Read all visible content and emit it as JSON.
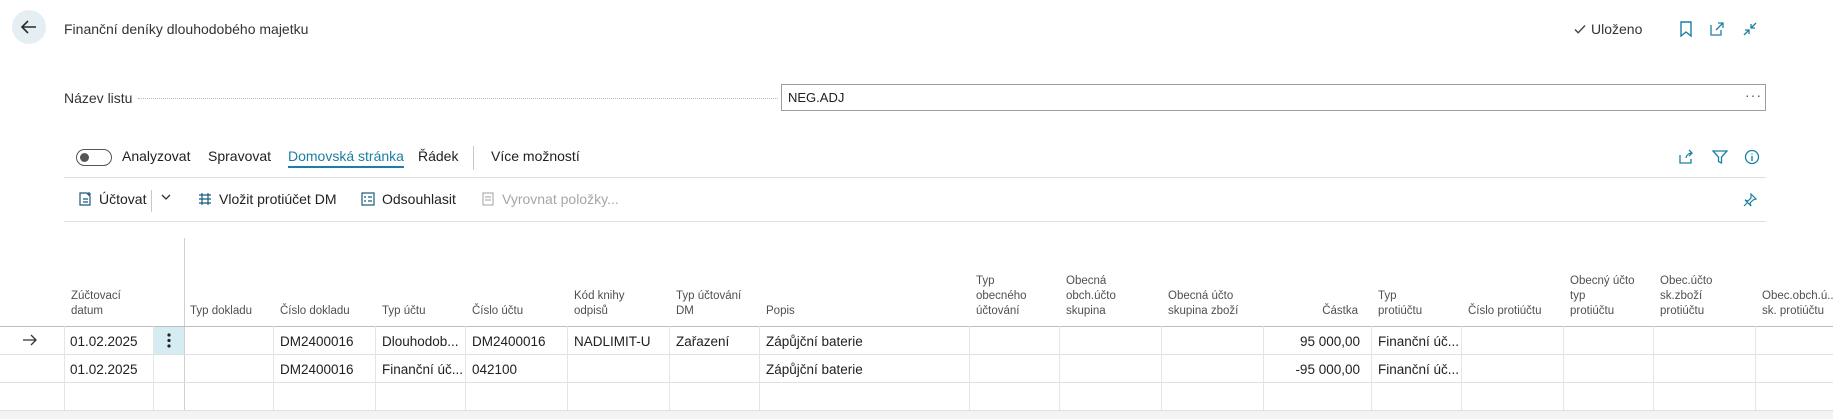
{
  "header": {
    "title": "Finanční deníky dlouhodobého majetku",
    "saved_label": "Uloženo"
  },
  "batch": {
    "label": "Název listu",
    "value": "NEG.ADJ",
    "more": "···"
  },
  "actionbar": {
    "analyze_label": "Analyzovat",
    "tabs": [
      "Spravovat",
      "Domovská stránka",
      "Řádek"
    ],
    "more_label": "Více možností"
  },
  "commands": {
    "post": "Účtovat",
    "insert_balancing": "Vložit protiúčet DM",
    "reconcile": "Odsouhlasit",
    "apply_entries": "Vyrovnat položky..."
  },
  "grid": {
    "columns": [
      {
        "l1": "Zúčtovací",
        "l2": "datum",
        "l3": ""
      },
      {
        "l1": "",
        "l2": "",
        "l3": "Typ dokladu"
      },
      {
        "l1": "",
        "l2": "",
        "l3": "Číslo dokladu"
      },
      {
        "l1": "",
        "l2": "",
        "l3": "Typ účtu"
      },
      {
        "l1": "",
        "l2": "",
        "l3": "Číslo účtu"
      },
      {
        "l1": "Kód knihy",
        "l2": "odpisů",
        "l3": ""
      },
      {
        "l1": "Typ účtování",
        "l2": "DM",
        "l3": ""
      },
      {
        "l1": "",
        "l2": "",
        "l3": "Popis"
      },
      {
        "l1": "Typ",
        "l2": "obecného",
        "l3": "účtování"
      },
      {
        "l1": "Obecná",
        "l2": "obch.účto",
        "l3": "skupina"
      },
      {
        "l1": "Obecná účto",
        "l2": "skupina zboží",
        "l3": ""
      },
      {
        "l1": "",
        "l2": "",
        "l3": "Částka"
      },
      {
        "l1": "Typ",
        "l2": "protiúčtu",
        "l3": ""
      },
      {
        "l1": "",
        "l2": "",
        "l3": "Číslo protiúčtu"
      },
      {
        "l1": "Obecný účto",
        "l2": "typ",
        "l3": "protiúčtu"
      },
      {
        "l1": "Obec.účto",
        "l2": "sk.zboží",
        "l3": "protiúčtu"
      },
      {
        "l1": "",
        "l2": "Obec.obch.ú...",
        "l3": "sk. protiúčtu"
      }
    ],
    "rows": [
      [
        "01.02.2025",
        "",
        "DM2400016",
        "Dlouhodob...",
        "DM2400016",
        "NADLIMIT-U",
        "Zařazení",
        "Zápůjční baterie",
        "",
        "",
        "",
        "95 000,00",
        "Finanční úč...",
        "",
        "",
        "",
        ""
      ],
      [
        "01.02.2025",
        "",
        "DM2400016",
        "Finanční úč...",
        "042100",
        "",
        "",
        "Zápůjční baterie",
        "",
        "",
        "",
        "-95 000,00",
        "Finanční úč...",
        "",
        "",
        "",
        ""
      ]
    ]
  },
  "colors": {
    "accent": "#1a7fa1",
    "back_button_bg": "#e4eef3",
    "selected_cell_bg": "#d6ecf3"
  }
}
